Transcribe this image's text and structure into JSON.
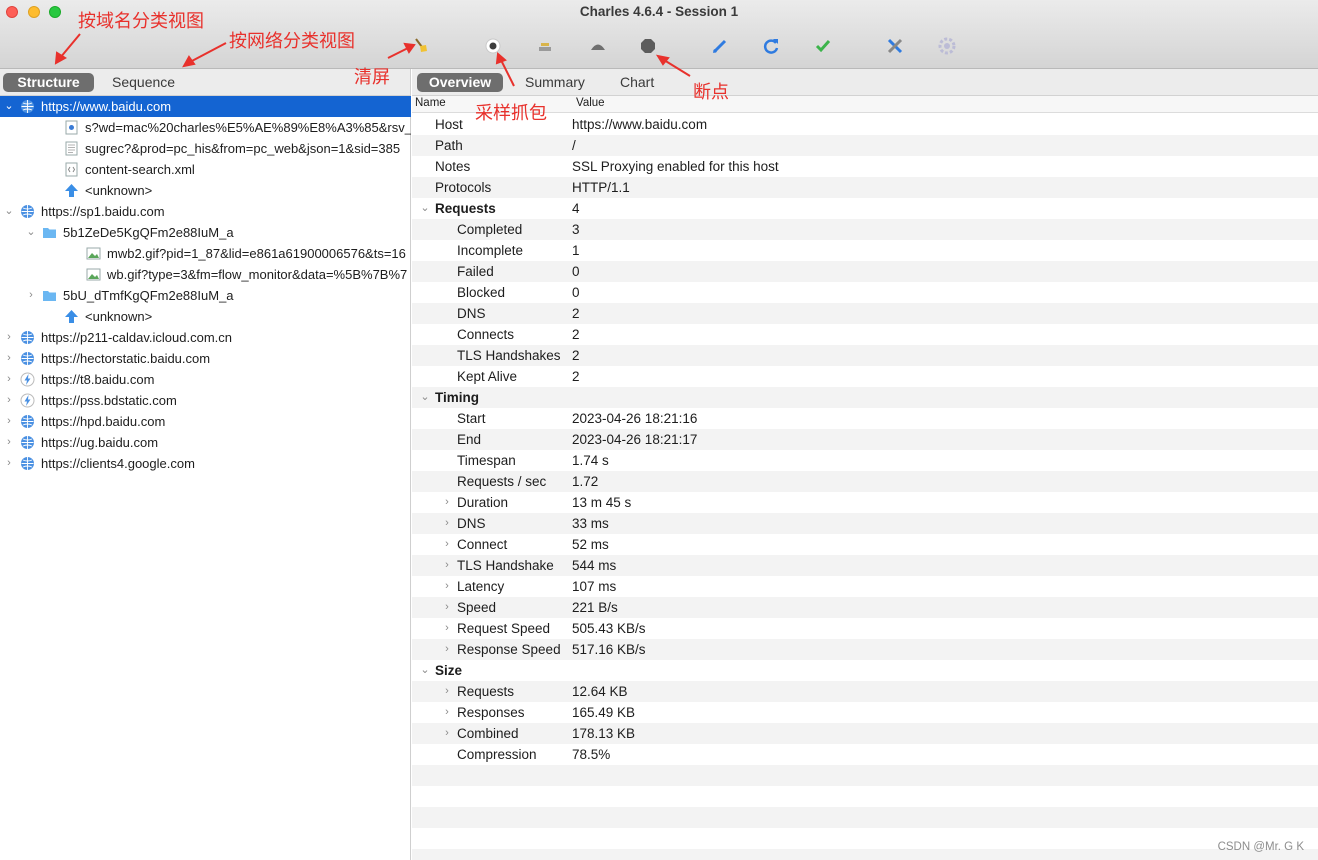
{
  "window": {
    "title": "Charles 4.6.4 - Session 1"
  },
  "toolbar": {
    "tools": [
      "broom-icon",
      "record-icon",
      "throttle-icon",
      "turtle-icon",
      "breakpoint-icon",
      "pen-icon",
      "refresh-icon",
      "check-icon",
      "tools-icon",
      "settings-icon"
    ]
  },
  "left": {
    "tabs": [
      "Structure",
      "Sequence"
    ],
    "active_tab": "Structure",
    "tree": [
      {
        "label": "https://www.baidu.com",
        "icon": "globe-icon",
        "expanded": true,
        "selected": true
      },
      {
        "label": "s?wd=mac%20charles%E5%AE%89%E8%A3%85&rsv_",
        "icon": "doc-icon"
      },
      {
        "label": "sugrec?&prod=pc_his&from=pc_web&json=1&sid=385",
        "icon": "text-icon"
      },
      {
        "label": "content-search.xml",
        "icon": "xml-icon"
      },
      {
        "label": "<unknown>",
        "icon": "upload-icon"
      },
      {
        "label": "https://sp1.baidu.com",
        "icon": "globe-icon",
        "expanded": true
      },
      {
        "label": "5b1ZeDe5KgQFm2e88IuM_a",
        "icon": "folder-icon",
        "expanded": true
      },
      {
        "label": "mwb2.gif?pid=1_87&lid=e861a61900006576&ts=16",
        "icon": "image-icon"
      },
      {
        "label": "wb.gif?type=3&fm=flow_monitor&data=%5B%7B%7",
        "icon": "image-icon"
      },
      {
        "label": "5bU_dTmfKgQFm2e88IuM_a",
        "icon": "folder-icon",
        "expanded": false
      },
      {
        "label": "<unknown>",
        "icon": "upload-icon"
      },
      {
        "label": "https://p211-caldav.icloud.com.cn",
        "icon": "globe-icon",
        "expanded": false
      },
      {
        "label": "https://hectorstatic.baidu.com",
        "icon": "globe-icon",
        "expanded": false
      },
      {
        "label": "https://t8.baidu.com",
        "icon": "bolt-icon",
        "expanded": false
      },
      {
        "label": "https://pss.bdstatic.com",
        "icon": "bolt-icon",
        "expanded": false
      },
      {
        "label": "https://hpd.baidu.com",
        "icon": "globe-icon",
        "expanded": false
      },
      {
        "label": "https://ug.baidu.com",
        "icon": "globe-icon",
        "expanded": false
      },
      {
        "label": "https://clients4.google.com",
        "icon": "globe-icon",
        "expanded": false
      }
    ]
  },
  "right": {
    "tabs": [
      "Overview",
      "Summary",
      "Chart"
    ],
    "active_tab": "Overview",
    "columns": [
      "Name",
      "Value"
    ],
    "rows": [
      {
        "name": "Host",
        "value": "https://www.baidu.com"
      },
      {
        "name": "Path",
        "value": "/"
      },
      {
        "name": "Notes",
        "value": "SSL Proxying enabled for this host"
      },
      {
        "name": "Protocols",
        "value": "HTTP/1.1"
      },
      {
        "name": "Requests",
        "value": "4",
        "group": true
      },
      {
        "name": "Completed",
        "value": "3"
      },
      {
        "name": "Incomplete",
        "value": "1"
      },
      {
        "name": "Failed",
        "value": "0"
      },
      {
        "name": "Blocked",
        "value": "0"
      },
      {
        "name": "DNS",
        "value": "2"
      },
      {
        "name": "Connects",
        "value": "2"
      },
      {
        "name": "TLS Handshakes",
        "value": "2"
      },
      {
        "name": "Kept Alive",
        "value": "2"
      },
      {
        "name": "Timing",
        "value": "",
        "group": true
      },
      {
        "name": "Start",
        "value": "2023-04-26 18:21:16"
      },
      {
        "name": "End",
        "value": "2023-04-26 18:21:17"
      },
      {
        "name": "Timespan",
        "value": "1.74 s"
      },
      {
        "name": "Requests / sec",
        "value": "1.72"
      },
      {
        "name": "Duration",
        "value": "13 m 45 s",
        "expandable": true
      },
      {
        "name": "DNS",
        "value": "33 ms",
        "expandable": true
      },
      {
        "name": "Connect",
        "value": "52 ms",
        "expandable": true
      },
      {
        "name": "TLS Handshake",
        "value": "544 ms",
        "expandable": true
      },
      {
        "name": "Latency",
        "value": "107 ms",
        "expandable": true
      },
      {
        "name": "Speed",
        "value": "221 B/s",
        "expandable": true
      },
      {
        "name": "Request Speed",
        "value": "505.43 KB/s",
        "expandable": true
      },
      {
        "name": "Response Speed",
        "value": "517.16 KB/s",
        "expandable": true
      },
      {
        "name": "Size",
        "value": "",
        "group": true
      },
      {
        "name": "Requests",
        "value": "12.64 KB",
        "expandable": true
      },
      {
        "name": "Responses",
        "value": "165.49 KB",
        "expandable": true
      },
      {
        "name": "Combined",
        "value": "178.13 KB",
        "expandable": true
      },
      {
        "name": "Compression",
        "value": "78.5%"
      }
    ]
  },
  "annotations": {
    "domain_view": "按域名分类视图",
    "network_view": "按网络分类视图",
    "clear": "清屏",
    "record": "采样抓包",
    "breakpoint": "断点"
  },
  "watermark": "CSDN @Mr. G K",
  "colors": {
    "selection": "#1464d2",
    "annotation": "#e8312c",
    "active_segment": "#6e6e6e"
  }
}
